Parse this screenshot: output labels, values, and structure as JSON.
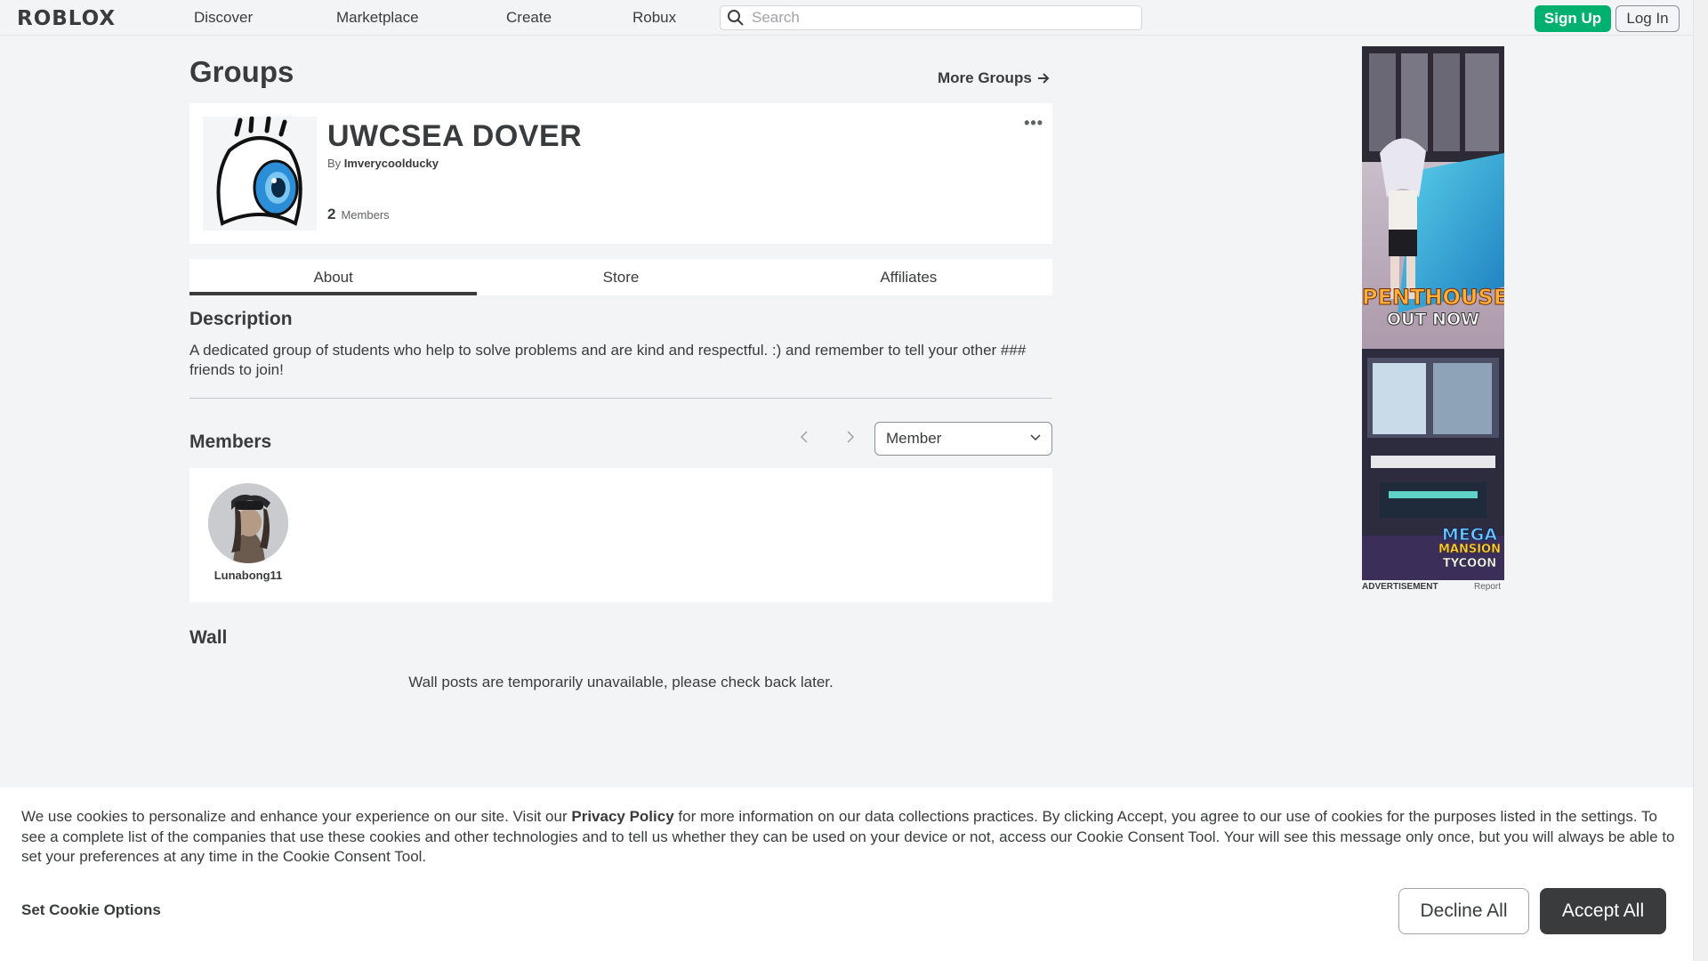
{
  "nav": {
    "logo": "ROBLOX",
    "links": [
      "Discover",
      "Marketplace",
      "Create",
      "Robux"
    ],
    "search_placeholder": "Search",
    "signup_label": "Sign Up",
    "login_label": "Log In"
  },
  "page": {
    "title": "Groups",
    "more_groups": "More Groups"
  },
  "group": {
    "name": "UWCSEA DOVER",
    "owner_prefix": "By",
    "owner": "Imverycoolducky",
    "member_count": "2",
    "member_label": "Members",
    "menu_glyph": "•••"
  },
  "tabs": [
    {
      "label": "About",
      "active": true
    },
    {
      "label": "Store",
      "active": false
    },
    {
      "label": "Affiliates",
      "active": false
    }
  ],
  "description": {
    "heading": "Description",
    "text": "A dedicated group of students who help to solve problems and are kind and respectful. :) and remember to tell your other ### friends to join!"
  },
  "members": {
    "heading": "Members",
    "role_selected": "Member",
    "list": [
      {
        "name": "Lunabong11"
      }
    ]
  },
  "wall": {
    "heading": "Wall",
    "message": "Wall posts are temporarily unavailable, please check back later."
  },
  "ad": {
    "label": "ADVERTISEMENT",
    "report": "Report",
    "line1": "PENTHOUSE",
    "line2": "OUT NOW",
    "line3": "MEGA",
    "line4": "MANSION",
    "line5": "TYCOON"
  },
  "cookie": {
    "text_before": "We use cookies to personalize and enhance your experience on our site. Visit our ",
    "link": "Privacy Policy",
    "text_after": " for more information on our data collections practices. By clicking Accept, you agree to our use of cookies for the purposes listed in the settings. To see a complete list of the companies that use these cookies and other technologies and to tell us whether they can be used on your device or not, access our Cookie Consent Tool. Your will see this message only once, but you will always be able to set your preferences at any time in the Cookie Consent Tool.",
    "options": "Set Cookie Options",
    "decline": "Decline All",
    "accept": "Accept All"
  },
  "colors": {
    "brand_green": "#00b06f",
    "text_dark": "#393b3d",
    "page_bg": "#f2f4f5"
  }
}
